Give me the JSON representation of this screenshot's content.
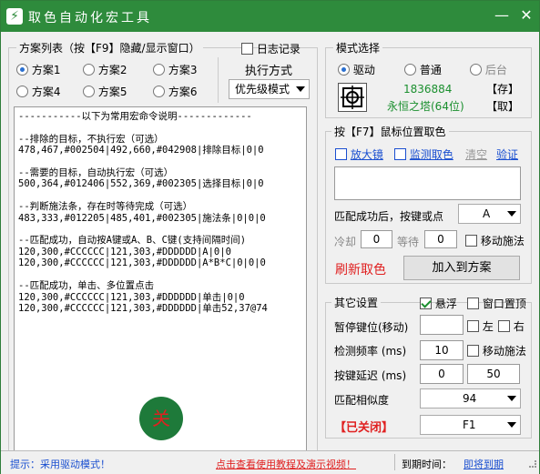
{
  "window": {
    "title": "取色自动化宏工具",
    "minimize_symbol": "—",
    "close_symbol": "✕",
    "app_icon": "lightning-icon",
    "app_icon_glyph": "⚡"
  },
  "scheme": {
    "group_title": "方案列表（按【F9】隐藏/显示窗口）",
    "log_label": "日志记录",
    "schemes": [
      "方案1",
      "方案2",
      "方案3",
      "方案4",
      "方案5",
      "方案6"
    ],
    "selected": "方案1",
    "exec_label": "执行方式",
    "exec_mode": "优先级模式"
  },
  "editor": {
    "text": "-----------以下为常用宏命令说明-------------\n\n--排除的目标，不执行宏（可选）\n478,467,#002504|492,660,#042908|排除目标|0|0\n\n--需要的目标，自动执行宏（可选）\n500,364,#012406|552,369,#002305|选择目标|0|0\n\n--判断施法条，存在时等待完成（可选）\n483,333,#012205|485,401,#002305|施法条|0|0|0\n\n--匹配成功，自动按A键或A、B、C键(支持间隔时间)\n120,300,#CCCCCC|121,303,#DDDDDD|A|0|0\n120,300,#CCCCCC|121,303,#DDDDDD|A*B*C|0|0|0\n\n--匹配成功，单击、多位置点击\n120,300,#CCCCCC|121,303,#DDDDDD|单击|0|0\n120,300,#CCCCCC|121,303,#DDDDDD|单击52,37@74"
  },
  "floating_button": {
    "label": "关",
    "color": "#1e7a3a",
    "text_color": "#e02020"
  },
  "mode": {
    "group_title": "模式选择",
    "options": [
      "驱动",
      "普通",
      "后台"
    ],
    "selected": "驱动",
    "code": "1836884",
    "name": "永恒之塔(64位)",
    "save_label": "【存】",
    "load_label": "【取】"
  },
  "pick": {
    "group_title": "按【F7】鼠标位置取色",
    "magnifier_label": "放大镜",
    "monitor_label": "监测取色",
    "clear_label": "清空",
    "verify_label": "验证",
    "after_match_label": "匹配成功后，按键或点",
    "key_value": "A",
    "cooldown_label": "冷却",
    "cooldown_value": "0",
    "wait_label": "等待",
    "wait_value": "0",
    "move_cast_label": "移动施法",
    "refresh_label": "刷新取色",
    "add_label": "加入到方案"
  },
  "settings": {
    "group_title": "其它设置",
    "float_label": "悬浮",
    "float_checked": true,
    "pin_label": "窗口置顶",
    "pause_label": "暂停键位(移动)",
    "left_label": "左",
    "right_label": "右",
    "freq_label": "检测频率 (ms)",
    "freq_value": "10",
    "freq_move_cast_label": "移动施法",
    "delay_label": "按键延迟 (ms)",
    "delay_min": "0",
    "delay_max": "50",
    "similarity_label": "匹配相似度",
    "similarity_value": "94",
    "state_label": "【已关闭】",
    "hotkey_value": "F1"
  },
  "status": {
    "hint": "提示：采用驱动模式！",
    "tutorial_link": "点击查看使用教程及演示视频！",
    "expire_label": "到期时间：",
    "renew_link": "即将到期"
  }
}
